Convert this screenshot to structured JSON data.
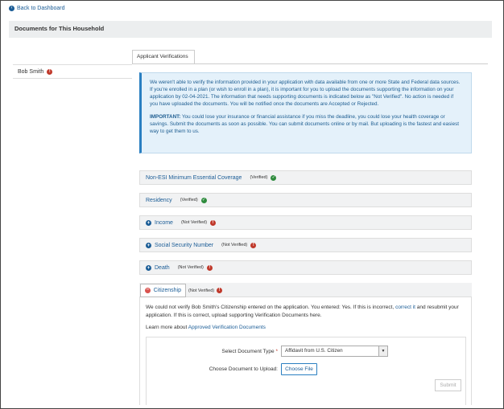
{
  "nav": {
    "back_label": "Back to Dashboard"
  },
  "household": {
    "title": "Documents for This Household"
  },
  "tabs": [
    {
      "label": "Applicant Verifications"
    }
  ],
  "person": {
    "name": "Bob Smith"
  },
  "info": {
    "paragraph1": "We weren't able to verify the information provided in your application with data available from one or more State and Federal data sources. If you're enrolled in a plan (or wish to enroll in a plan), it is important for you to upload the documents supporting the information on your application by 02-04-2021. The information that needs supporting documents is indicated below as \"Not Verified\". No action is needed if you have uploaded the documents. You will be notified once the documents are Accepted or Rejected.",
    "important_label": "IMPORTANT:",
    "paragraph2": " You could lose your insurance or financial assistance if you miss the deadline, you could lose your health coverage or savings. Submit the documents as soon as possible. You can submit documents online or by mail. But uploading is the fastest and easiest way to get them to us."
  },
  "verifications": [
    {
      "name": "Non-ESI Minimum Essential Coverage",
      "status": "(Verified)"
    },
    {
      "name": "Residency",
      "status": "(Verified)"
    },
    {
      "name": "Income",
      "status": "(Not Verified)"
    },
    {
      "name": "Social Security Number",
      "status": "(Not Verified)"
    },
    {
      "name": "Death",
      "status": "(Not Verified)"
    }
  ],
  "citizenship": {
    "name": "Citizenship",
    "status": "(Not Verified)",
    "message_part1": "We could not verify Bob Smith's Citizenship entered on the application. You entered: Yes. If this is incorrect, ",
    "correct_link": "correct it",
    "message_part2": " and resubmit your application. If this is correct, upload supporting Verification Documents here.",
    "learn_prefix": "Learn more about ",
    "learn_link": "Approved Verification Documents",
    "doc_type_label": "Select Document Type",
    "required_mark": "*",
    "doc_type_value": "Affidavit from U.S. Citizen",
    "choose_label": "Choose Document to Upload:",
    "choose_button": "Choose File",
    "submit_button": "Submit"
  },
  "colors": {
    "link": "#1a5c96",
    "warning": "#c0392b",
    "success": "#2e8b3d",
    "info_bg": "#e4f1fa"
  }
}
